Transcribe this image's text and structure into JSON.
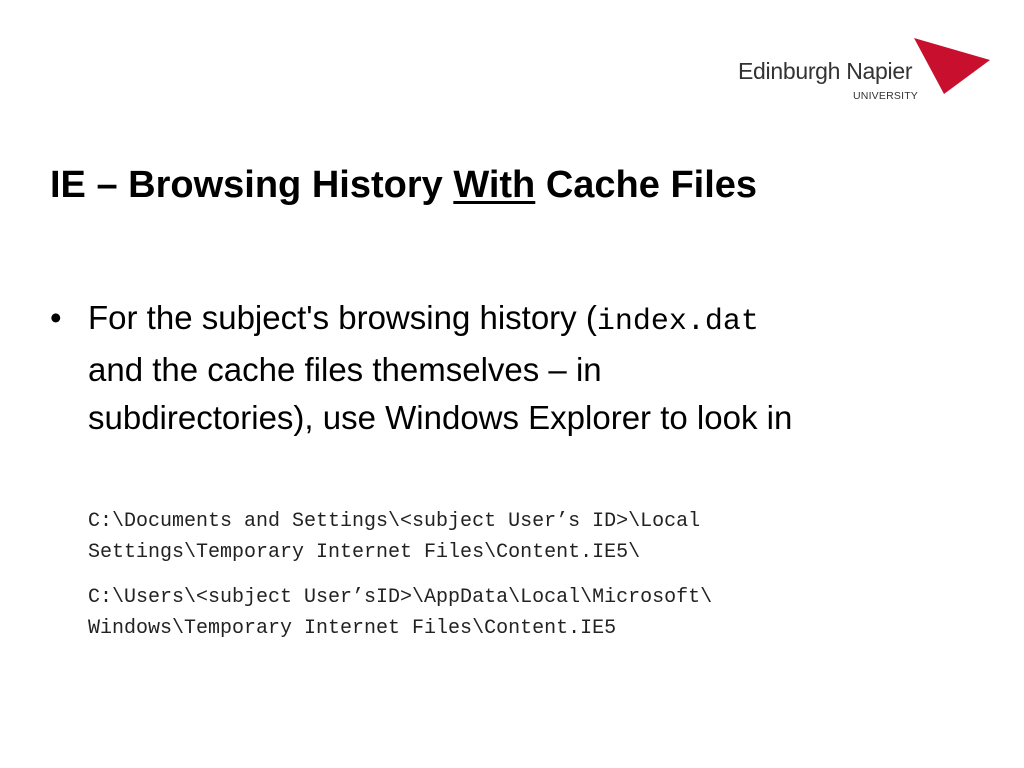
{
  "logo": {
    "name": "Edinburgh Napier",
    "subtitle": "UNIVERSITY",
    "flag_color": "#c8102e"
  },
  "slide": {
    "title_part1": "IE – Browsing History ",
    "title_emphasis": "With",
    "title_part2": " Cache Files",
    "bullet_symbol": "•",
    "bullet_text_before": "For the subject's browsing history (",
    "bullet_code": "index.dat",
    "bullet_text_line2": "and the cache files themselves – in",
    "bullet_text_line3": "subdirectories), use Windows Explorer to look in",
    "paths": [
      {
        "line1": "C:\\Documents and Settings\\<subject User’s ID>\\Local",
        "line2": "Settings\\Temporary Internet Files\\Content.IE5\\"
      },
      {
        "line1": "C:\\Users\\<subject User’sID>\\AppData\\Local\\Microsoft\\",
        "line2": "Windows\\Temporary Internet Files\\Content.IE5"
      }
    ]
  }
}
